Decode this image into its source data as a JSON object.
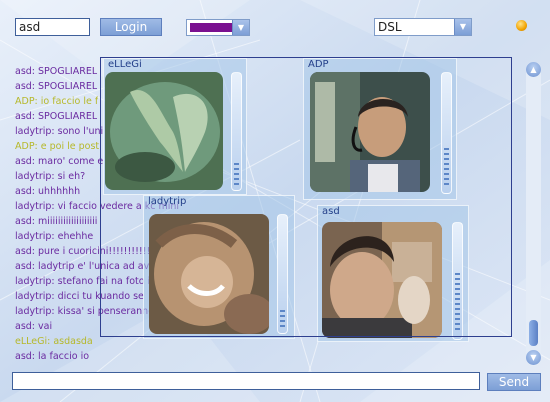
{
  "topbar": {
    "username_value": "asd",
    "login_label": "Login",
    "text_color": "#7a1090",
    "connection_value": "DSL",
    "status_color": "#f2a300"
  },
  "chat": {
    "messages": [
      {
        "text": "asd: SPOGLIAREL"
      },
      {
        "text": "asd: SPOGLIAREL"
      },
      {
        "text": "ADP: io faccio le f"
      },
      {
        "text": "asd: SPOGLIAREL"
      },
      {
        "text": "ladytrip: sono l'uni"
      },
      {
        "text": "ADP: e poi le post"
      },
      {
        "text": "asd: maro' come e"
      },
      {
        "text": "ladytrip: si eh?"
      },
      {
        "text": "asd: uhhhhhh"
      },
      {
        "text": "ladytrip: vi faccio vedere a kc   mini"
      },
      {
        "text": "asd: miiiiiiiiiiiiiiiiiii"
      },
      {
        "text": "ladytrip: ehehhe"
      },
      {
        "text": "asd: pure i cuoricini!!!!!!!!!!!!!!!!!"
      },
      {
        "text": "asd: ladytrip e' l'unica ad av                               ale"
      },
      {
        "text": "ladytrip: stefano fai na foto i                                A  kon i"
      },
      {
        "text": "ladytrip: dicci tu kuando se"
      },
      {
        "text": "ladytrip: kissa' si penseranno                              ydoll"
      },
      {
        "text": "asd: vai"
      },
      {
        "text": "eLLeGi: asdasda"
      },
      {
        "text": "asd: la faccio io"
      }
    ]
  },
  "videos": {
    "p1": {
      "name": "eLLeGi"
    },
    "p2": {
      "name": "ADP"
    },
    "p3": {
      "name": "ladytrip"
    },
    "p4": {
      "name": "asd"
    }
  },
  "bottom": {
    "message_value": "",
    "send_label": "Send"
  },
  "icons": {
    "dropdown": "chevron-down-icon",
    "scroll_up": "arrow-up-icon",
    "scroll_down": "arrow-down-icon"
  }
}
